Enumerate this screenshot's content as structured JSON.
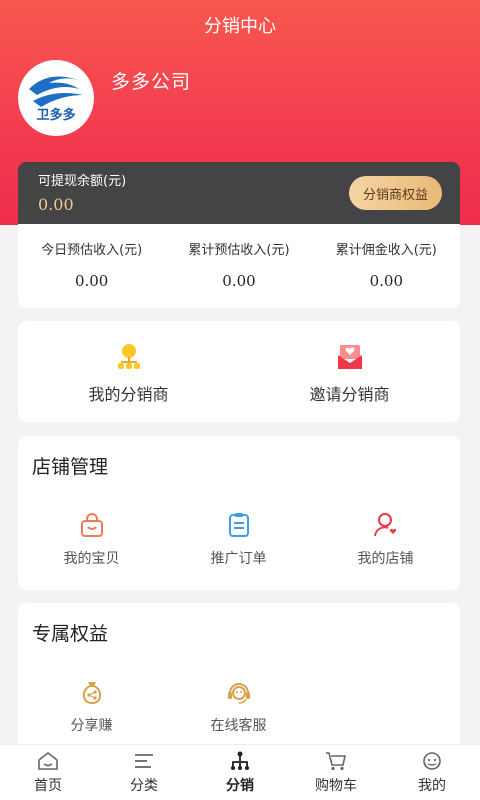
{
  "header": {
    "title": "分销中心"
  },
  "profile": {
    "company": "多多公司",
    "logo_text": "卫多多"
  },
  "balance": {
    "label": "可提现余额(元)",
    "value": "0.00",
    "rights_button": "分销商权益"
  },
  "stats": [
    {
      "label": "今日预估收入(元)",
      "value": "0.00"
    },
    {
      "label": "累计预估收入(元)",
      "value": "0.00"
    },
    {
      "label": "累计佣金收入(元)",
      "value": "0.00"
    }
  ],
  "distribution": [
    {
      "label": "我的分销商",
      "icon": "distributor-icon"
    },
    {
      "label": "邀请分销商",
      "icon": "invite-icon"
    }
  ],
  "shop": {
    "title": "店铺管理",
    "items": [
      {
        "label": "我的宝贝",
        "icon": "bag-icon"
      },
      {
        "label": "推广订单",
        "icon": "order-icon"
      },
      {
        "label": "我的店铺",
        "icon": "shop-user-icon"
      }
    ]
  },
  "perks": {
    "title": "专属权益",
    "items": [
      {
        "label": "分享赚",
        "icon": "share-earn-icon"
      },
      {
        "label": "在线客服",
        "icon": "customer-service-icon"
      }
    ]
  },
  "tabbar": [
    {
      "label": "首页",
      "icon": "home-icon"
    },
    {
      "label": "分类",
      "icon": "category-icon"
    },
    {
      "label": "分销",
      "icon": "distribution-icon"
    },
    {
      "label": "购物车",
      "icon": "cart-icon"
    },
    {
      "label": "我的",
      "icon": "profile-icon"
    }
  ],
  "colors": {
    "header": "#f33d4f",
    "gold": "#f0c98b",
    "dark_card": "#444447"
  }
}
